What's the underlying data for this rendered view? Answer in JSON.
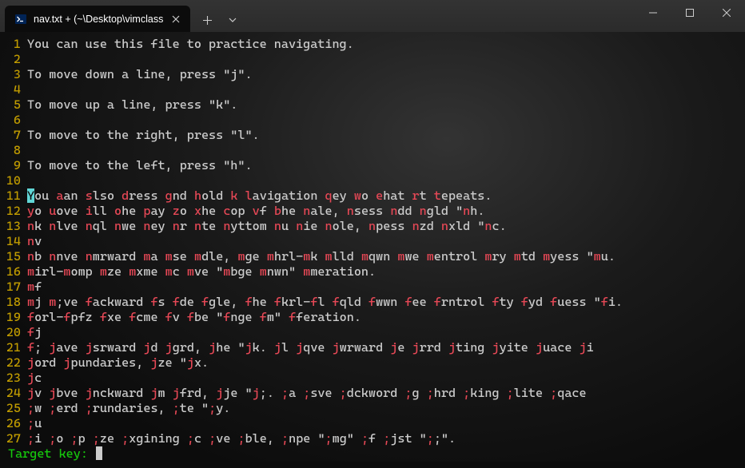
{
  "tab": {
    "title": "nav.txt + (~\\Desktop\\vimclass"
  },
  "lines": [
    {
      "n": "1",
      "segments": [
        {
          "t": "You can use this file to practice navigating."
        }
      ]
    },
    {
      "n": "2",
      "segments": []
    },
    {
      "n": "3",
      "segments": [
        {
          "t": "To move down a line, press \"j\"."
        }
      ]
    },
    {
      "n": "4",
      "segments": []
    },
    {
      "n": "5",
      "segments": [
        {
          "t": "To move up a line, press \"k\"."
        }
      ]
    },
    {
      "n": "6",
      "segments": []
    },
    {
      "n": "7",
      "segments": [
        {
          "t": "To move to the right, press \"l\"."
        }
      ]
    },
    {
      "n": "8",
      "segments": []
    },
    {
      "n": "9",
      "segments": [
        {
          "t": "To move to the left, press \"h\"."
        }
      ]
    },
    {
      "n": "10",
      "segments": []
    },
    {
      "n": "11",
      "segments": [
        {
          "t": "Y",
          "c": "cursor-char"
        },
        {
          "t": "ou "
        },
        {
          "t": "a",
          "c": "hl"
        },
        {
          "t": "an "
        },
        {
          "t": "s",
          "c": "hl"
        },
        {
          "t": "lso "
        },
        {
          "t": "d",
          "c": "hl"
        },
        {
          "t": "ress "
        },
        {
          "t": "g",
          "c": "hl"
        },
        {
          "t": "nd "
        },
        {
          "t": "h",
          "c": "hl"
        },
        {
          "t": "old "
        },
        {
          "t": "k",
          "c": "hl"
        },
        {
          "t": " "
        },
        {
          "t": "l",
          "c": "hl"
        },
        {
          "t": "avigation "
        },
        {
          "t": "q",
          "c": "hl"
        },
        {
          "t": "ey "
        },
        {
          "t": "w",
          "c": "hl"
        },
        {
          "t": "o "
        },
        {
          "t": "e",
          "c": "hl"
        },
        {
          "t": "hat "
        },
        {
          "t": "r",
          "c": "hl"
        },
        {
          "t": "t "
        },
        {
          "t": "t",
          "c": "hl"
        },
        {
          "t": "epeats."
        }
      ]
    },
    {
      "n": "12",
      "segments": [
        {
          "t": "y",
          "c": "hl"
        },
        {
          "t": "o "
        },
        {
          "t": "u",
          "c": "hl"
        },
        {
          "t": "ove "
        },
        {
          "t": "i",
          "c": "hl"
        },
        {
          "t": "ll "
        },
        {
          "t": "o",
          "c": "hl"
        },
        {
          "t": "he "
        },
        {
          "t": "p",
          "c": "hl"
        },
        {
          "t": "ay "
        },
        {
          "t": "z",
          "c": "hl"
        },
        {
          "t": "o "
        },
        {
          "t": "x",
          "c": "hl"
        },
        {
          "t": "he "
        },
        {
          "t": "c",
          "c": "hl"
        },
        {
          "t": "op "
        },
        {
          "t": "v",
          "c": "hl"
        },
        {
          "t": "f "
        },
        {
          "t": "b",
          "c": "hl"
        },
        {
          "t": "he "
        },
        {
          "t": "n",
          "c": "hl"
        },
        {
          "t": "ale, "
        },
        {
          "t": "n",
          "c": "hl"
        },
        {
          "t": "sess "
        },
        {
          "t": "n",
          "c": "hl"
        },
        {
          "t": "dd "
        },
        {
          "t": "n",
          "c": "hl"
        },
        {
          "t": "gld \""
        },
        {
          "t": "n",
          "c": "hl"
        },
        {
          "t": "h."
        }
      ]
    },
    {
      "n": "13",
      "segments": [
        {
          "t": "n",
          "c": "hl"
        },
        {
          "t": "k "
        },
        {
          "t": "n",
          "c": "hl"
        },
        {
          "t": "lve "
        },
        {
          "t": "n",
          "c": "hl"
        },
        {
          "t": "ql "
        },
        {
          "t": "n",
          "c": "hl"
        },
        {
          "t": "we "
        },
        {
          "t": "n",
          "c": "hl"
        },
        {
          "t": "ey "
        },
        {
          "t": "n",
          "c": "hl"
        },
        {
          "t": "r "
        },
        {
          "t": "n",
          "c": "hl"
        },
        {
          "t": "te "
        },
        {
          "t": "n",
          "c": "hl"
        },
        {
          "t": "yttom "
        },
        {
          "t": "n",
          "c": "hl"
        },
        {
          "t": "u "
        },
        {
          "t": "n",
          "c": "hl"
        },
        {
          "t": "ie "
        },
        {
          "t": "n",
          "c": "hl"
        },
        {
          "t": "ole, "
        },
        {
          "t": "n",
          "c": "hl"
        },
        {
          "t": "pess "
        },
        {
          "t": "n",
          "c": "hl"
        },
        {
          "t": "zd "
        },
        {
          "t": "n",
          "c": "hl"
        },
        {
          "t": "xld \""
        },
        {
          "t": "n",
          "c": "hl"
        },
        {
          "t": "c."
        }
      ]
    },
    {
      "n": "14",
      "segments": [
        {
          "t": "n",
          "c": "hl"
        },
        {
          "t": "v"
        }
      ]
    },
    {
      "n": "15",
      "segments": [
        {
          "t": "n",
          "c": "hl"
        },
        {
          "t": "b "
        },
        {
          "t": "n",
          "c": "hl"
        },
        {
          "t": "nve "
        },
        {
          "t": "n",
          "c": "hl"
        },
        {
          "t": "mrward "
        },
        {
          "t": "m",
          "c": "hl"
        },
        {
          "t": "a "
        },
        {
          "t": "m",
          "c": "hl"
        },
        {
          "t": "se "
        },
        {
          "t": "m",
          "c": "hl"
        },
        {
          "t": "dle, "
        },
        {
          "t": "m",
          "c": "hl"
        },
        {
          "t": "ge "
        },
        {
          "t": "m",
          "c": "hl"
        },
        {
          "t": "hrl-"
        },
        {
          "t": "m",
          "c": "hl"
        },
        {
          "t": "k "
        },
        {
          "t": "m",
          "c": "hl"
        },
        {
          "t": "lld "
        },
        {
          "t": "m",
          "c": "hl"
        },
        {
          "t": "qwn "
        },
        {
          "t": "m",
          "c": "hl"
        },
        {
          "t": "we "
        },
        {
          "t": "m",
          "c": "hl"
        },
        {
          "t": "entrol "
        },
        {
          "t": "m",
          "c": "hl"
        },
        {
          "t": "ry "
        },
        {
          "t": "m",
          "c": "hl"
        },
        {
          "t": "td "
        },
        {
          "t": "m",
          "c": "hl"
        },
        {
          "t": "yess \""
        },
        {
          "t": "m",
          "c": "hl"
        },
        {
          "t": "u."
        }
      ]
    },
    {
      "n": "16",
      "segments": [
        {
          "t": "m",
          "c": "hl"
        },
        {
          "t": "irl-"
        },
        {
          "t": "m",
          "c": "hl"
        },
        {
          "t": "omp "
        },
        {
          "t": "m",
          "c": "hl"
        },
        {
          "t": "ze "
        },
        {
          "t": "m",
          "c": "hl"
        },
        {
          "t": "xme "
        },
        {
          "t": "m",
          "c": "hl"
        },
        {
          "t": "c "
        },
        {
          "t": "m",
          "c": "hl"
        },
        {
          "t": "ve \""
        },
        {
          "t": "m",
          "c": "hl"
        },
        {
          "t": "bge "
        },
        {
          "t": "m",
          "c": "hl"
        },
        {
          "t": "nwn\" "
        },
        {
          "t": "m",
          "c": "hl"
        },
        {
          "t": "meration."
        }
      ]
    },
    {
      "n": "17",
      "segments": [
        {
          "t": "m",
          "c": "hl"
        },
        {
          "t": "f"
        }
      ]
    },
    {
      "n": "18",
      "segments": [
        {
          "t": "m",
          "c": "hl"
        },
        {
          "t": "j "
        },
        {
          "t": "m",
          "c": "hl"
        },
        {
          "t": ";ve "
        },
        {
          "t": "f",
          "c": "hl"
        },
        {
          "t": "ackward "
        },
        {
          "t": "f",
          "c": "hl"
        },
        {
          "t": "s "
        },
        {
          "t": "f",
          "c": "hl"
        },
        {
          "t": "de "
        },
        {
          "t": "f",
          "c": "hl"
        },
        {
          "t": "gle, "
        },
        {
          "t": "f",
          "c": "hl"
        },
        {
          "t": "he "
        },
        {
          "t": "f",
          "c": "hl"
        },
        {
          "t": "krl-"
        },
        {
          "t": "f",
          "c": "hl"
        },
        {
          "t": "l "
        },
        {
          "t": "f",
          "c": "hl"
        },
        {
          "t": "qld "
        },
        {
          "t": "f",
          "c": "hl"
        },
        {
          "t": "wwn "
        },
        {
          "t": "f",
          "c": "hl"
        },
        {
          "t": "ee "
        },
        {
          "t": "f",
          "c": "hl"
        },
        {
          "t": "rntrol "
        },
        {
          "t": "f",
          "c": "hl"
        },
        {
          "t": "ty "
        },
        {
          "t": "f",
          "c": "hl"
        },
        {
          "t": "yd "
        },
        {
          "t": "f",
          "c": "hl"
        },
        {
          "t": "uess \""
        },
        {
          "t": "f",
          "c": "hl"
        },
        {
          "t": "i."
        }
      ]
    },
    {
      "n": "19",
      "segments": [
        {
          "t": "f",
          "c": "hl"
        },
        {
          "t": "orl-"
        },
        {
          "t": "f",
          "c": "hl"
        },
        {
          "t": "pfz "
        },
        {
          "t": "f",
          "c": "hl"
        },
        {
          "t": "xe "
        },
        {
          "t": "f",
          "c": "hl"
        },
        {
          "t": "cme "
        },
        {
          "t": "f",
          "c": "hl"
        },
        {
          "t": "v "
        },
        {
          "t": "f",
          "c": "hl"
        },
        {
          "t": "be \""
        },
        {
          "t": "f",
          "c": "hl"
        },
        {
          "t": "nge "
        },
        {
          "t": "f",
          "c": "hl"
        },
        {
          "t": "m\" "
        },
        {
          "t": "f",
          "c": "hl"
        },
        {
          "t": "feration."
        }
      ]
    },
    {
      "n": "20",
      "segments": [
        {
          "t": "f",
          "c": "hl"
        },
        {
          "t": "j"
        }
      ]
    },
    {
      "n": "21",
      "segments": [
        {
          "t": "f",
          "c": "hl"
        },
        {
          "t": "; "
        },
        {
          "t": "j",
          "c": "hl"
        },
        {
          "t": "ave "
        },
        {
          "t": "j",
          "c": "hl"
        },
        {
          "t": "srward "
        },
        {
          "t": "j",
          "c": "hl"
        },
        {
          "t": "d "
        },
        {
          "t": "j",
          "c": "hl"
        },
        {
          "t": "grd, "
        },
        {
          "t": "j",
          "c": "hl"
        },
        {
          "t": "he \""
        },
        {
          "t": "j",
          "c": "hl"
        },
        {
          "t": "k. "
        },
        {
          "t": "j",
          "c": "hl"
        },
        {
          "t": "l "
        },
        {
          "t": "j",
          "c": "hl"
        },
        {
          "t": "qve "
        },
        {
          "t": "j",
          "c": "hl"
        },
        {
          "t": "wrward "
        },
        {
          "t": "j",
          "c": "hl"
        },
        {
          "t": "e "
        },
        {
          "t": "j",
          "c": "hl"
        },
        {
          "t": "rrd "
        },
        {
          "t": "j",
          "c": "hl"
        },
        {
          "t": "ting "
        },
        {
          "t": "j",
          "c": "hl"
        },
        {
          "t": "yite "
        },
        {
          "t": "j",
          "c": "hl"
        },
        {
          "t": "uace "
        },
        {
          "t": "j",
          "c": "hl"
        },
        {
          "t": "i"
        }
      ]
    },
    {
      "n": "22",
      "segments": [
        {
          "t": "j",
          "c": "hl"
        },
        {
          "t": "ord "
        },
        {
          "t": "j",
          "c": "hl"
        },
        {
          "t": "pundaries, "
        },
        {
          "t": "j",
          "c": "hl"
        },
        {
          "t": "ze \""
        },
        {
          "t": "j",
          "c": "hl"
        },
        {
          "t": "x."
        }
      ]
    },
    {
      "n": "23",
      "segments": [
        {
          "t": "j",
          "c": "hl"
        },
        {
          "t": "c"
        }
      ]
    },
    {
      "n": "24",
      "segments": [
        {
          "t": "j",
          "c": "hl"
        },
        {
          "t": "v "
        },
        {
          "t": "j",
          "c": "hl"
        },
        {
          "t": "bve "
        },
        {
          "t": "j",
          "c": "hl"
        },
        {
          "t": "nckward "
        },
        {
          "t": "j",
          "c": "hl"
        },
        {
          "t": "m "
        },
        {
          "t": "j",
          "c": "hl"
        },
        {
          "t": "frd, "
        },
        {
          "t": "j",
          "c": "hl"
        },
        {
          "t": "je \""
        },
        {
          "t": "j",
          "c": "hl"
        },
        {
          "t": ";. "
        },
        {
          "t": ";",
          "c": "hl"
        },
        {
          "t": "a "
        },
        {
          "t": ";",
          "c": "hl"
        },
        {
          "t": "sve "
        },
        {
          "t": ";",
          "c": "hl"
        },
        {
          "t": "dckword "
        },
        {
          "t": ";",
          "c": "hl"
        },
        {
          "t": "g "
        },
        {
          "t": ";",
          "c": "hl"
        },
        {
          "t": "hrd "
        },
        {
          "t": ";",
          "c": "hl"
        },
        {
          "t": "king "
        },
        {
          "t": ";",
          "c": "hl"
        },
        {
          "t": "lite "
        },
        {
          "t": ";",
          "c": "hl"
        },
        {
          "t": "qace"
        }
      ]
    },
    {
      "n": "25",
      "segments": [
        {
          "t": ";",
          "c": "hl"
        },
        {
          "t": "w "
        },
        {
          "t": ";",
          "c": "hl"
        },
        {
          "t": "erd "
        },
        {
          "t": ";",
          "c": "hl"
        },
        {
          "t": "rundaries, "
        },
        {
          "t": ";",
          "c": "hl"
        },
        {
          "t": "te \""
        },
        {
          "t": ";",
          "c": "hl"
        },
        {
          "t": "y."
        }
      ]
    },
    {
      "n": "26",
      "segments": [
        {
          "t": ";",
          "c": "hl"
        },
        {
          "t": "u"
        }
      ]
    },
    {
      "n": "27",
      "segments": [
        {
          "t": ";",
          "c": "hl"
        },
        {
          "t": "i "
        },
        {
          "t": ";",
          "c": "hl"
        },
        {
          "t": "o "
        },
        {
          "t": ";",
          "c": "hl"
        },
        {
          "t": "p "
        },
        {
          "t": ";",
          "c": "hl"
        },
        {
          "t": "ze "
        },
        {
          "t": ";",
          "c": "hl"
        },
        {
          "t": "xgining "
        },
        {
          "t": ";",
          "c": "hl"
        },
        {
          "t": "c "
        },
        {
          "t": ";",
          "c": "hl"
        },
        {
          "t": "ve "
        },
        {
          "t": ";",
          "c": "hl"
        },
        {
          "t": "ble, "
        },
        {
          "t": ";",
          "c": "hl"
        },
        {
          "t": "npe \""
        },
        {
          "t": ";",
          "c": "hl"
        },
        {
          "t": "mg\" "
        },
        {
          "t": ";",
          "c": "hl"
        },
        {
          "t": "f "
        },
        {
          "t": ";",
          "c": "hl"
        },
        {
          "t": "jst \""
        },
        {
          "t": ";",
          "c": "hl"
        },
        {
          "t": ";\"."
        }
      ]
    }
  ],
  "prompt": "Target key: "
}
